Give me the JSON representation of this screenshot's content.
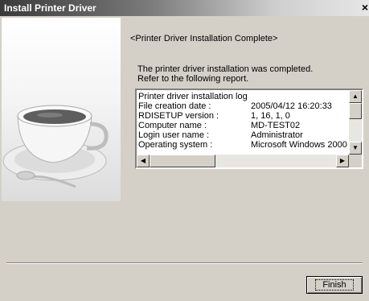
{
  "window": {
    "title": "Install Printer Driver",
    "close_symbol": "×"
  },
  "content": {
    "heading": "<Printer Driver Installation Complete>",
    "message_line1": "The printer driver installation was completed.",
    "message_line2": "Refer to the following report."
  },
  "log": {
    "header": "Printer driver installation log",
    "rows": [
      {
        "label": "File creation date :",
        "value": "2005/04/12 16:20:33"
      },
      {
        "label": "RDISETUP version :",
        "value": "1, 16, 1, 0"
      },
      {
        "label": "Computer name :",
        "value": "MD-TEST02"
      },
      {
        "label": "Login user name :",
        "value": "Administrator"
      },
      {
        "label": "Operating system :",
        "value": "Microsoft Windows 2000"
      }
    ]
  },
  "buttons": {
    "finish": "Finish"
  },
  "icons": {
    "art": "coffee-cup-illustration",
    "close": "close-icon",
    "scroll_up": "arrow-up-icon",
    "scroll_down": "arrow-down-icon",
    "scroll_left": "arrow-left-icon",
    "scroll_right": "arrow-right-icon"
  }
}
